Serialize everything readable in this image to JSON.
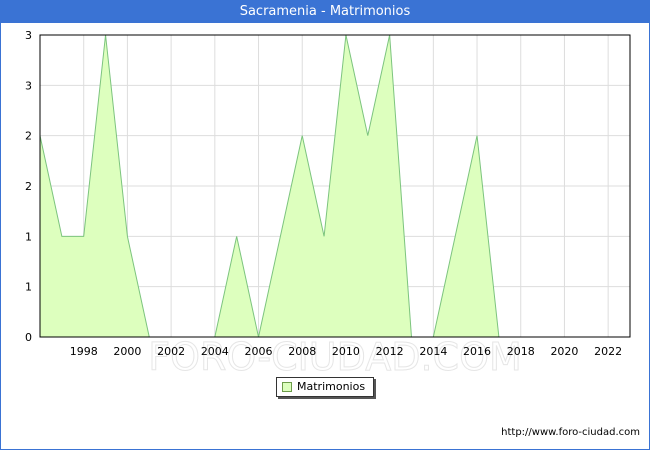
{
  "title": "Sacramenia - Matrimonios",
  "source_url": "http://www.foro-ciudad.com",
  "watermark": "FORO-CIUDAD.COM",
  "colors": {
    "header": "#3a73d4",
    "fill": "#ddffbe",
    "line": "#7cc47e",
    "grid": "#dddddd"
  },
  "chart_data": {
    "type": "area",
    "title": "Sacramenia - Matrimonios",
    "xlabel": "",
    "ylabel": "",
    "x": [
      1996,
      1997,
      1998,
      1999,
      2000,
      2001,
      2002,
      2003,
      2004,
      2005,
      2006,
      2007,
      2008,
      2009,
      2010,
      2011,
      2012,
      2013,
      2014,
      2015,
      2016,
      2017,
      2018,
      2019,
      2020,
      2021,
      2022,
      2023
    ],
    "series": [
      {
        "name": "Matrimonios",
        "values": [
          2,
          1,
          1,
          3,
          1,
          0,
          0,
          0,
          0,
          1,
          0,
          1,
          2,
          1,
          3,
          2,
          3,
          0,
          0,
          1,
          2,
          0,
          0,
          0,
          0,
          0,
          0,
          0
        ]
      }
    ],
    "xlim": [
      1996,
      2023
    ],
    "ylim": [
      0,
      3
    ],
    "x_ticks": [
      "1998",
      "2000",
      "2002",
      "2004",
      "2006",
      "2008",
      "2010",
      "2012",
      "2014",
      "2016",
      "2018",
      "2020",
      "2022"
    ],
    "y_ticks": [
      "0",
      "1",
      "1",
      "2",
      "2",
      "3",
      "3"
    ],
    "grid": true,
    "legend_position": "bottom-center"
  }
}
